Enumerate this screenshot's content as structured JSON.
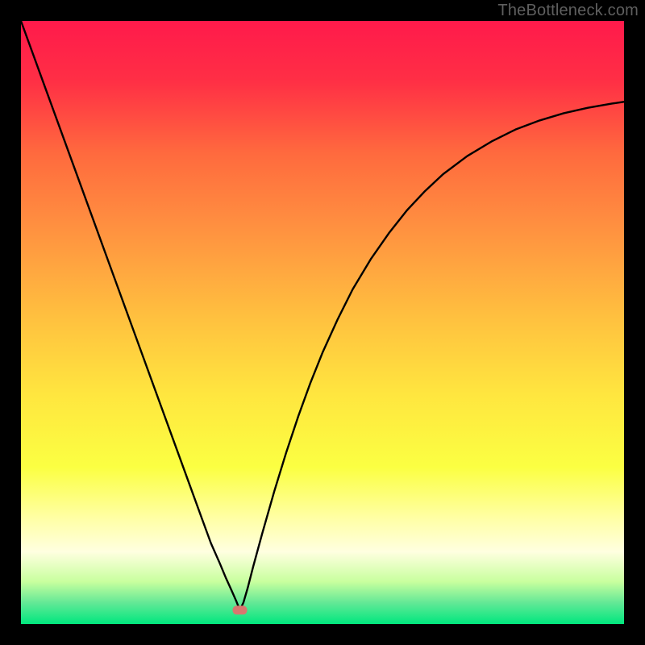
{
  "watermark": "TheBottleneck.com",
  "chart_data": {
    "type": "line",
    "title": "",
    "xlabel": "",
    "ylabel": "",
    "xlim": [
      0,
      100
    ],
    "ylim": [
      0,
      100
    ],
    "grid": false,
    "legend": false,
    "background_gradient": {
      "stops": [
        {
          "offset": 0.0,
          "color": "#ff1a4b"
        },
        {
          "offset": 0.1,
          "color": "#ff2f45"
        },
        {
          "offset": 0.22,
          "color": "#ff6a3e"
        },
        {
          "offset": 0.35,
          "color": "#ff9340"
        },
        {
          "offset": 0.5,
          "color": "#ffc33f"
        },
        {
          "offset": 0.62,
          "color": "#ffe63f"
        },
        {
          "offset": 0.74,
          "color": "#fbff42"
        },
        {
          "offset": 0.82,
          "color": "#ffffa0"
        },
        {
          "offset": 0.88,
          "color": "#ffffe0"
        },
        {
          "offset": 0.93,
          "color": "#c8ff9e"
        },
        {
          "offset": 0.965,
          "color": "#62e896"
        },
        {
          "offset": 1.0,
          "color": "#00e77e"
        }
      ]
    },
    "minimum_marker": {
      "x": 36.3,
      "y": 2.3,
      "color": "#d8776f"
    },
    "series": [
      {
        "name": "curve",
        "color": "#000000",
        "x": [
          0.0,
          2.0,
          4.0,
          6.0,
          8.0,
          10.0,
          12.0,
          14.0,
          16.0,
          18.0,
          20.0,
          22.0,
          24.0,
          26.0,
          28.0,
          30.0,
          31.5,
          33.0,
          34.0,
          35.0,
          35.7,
          36.3,
          36.9,
          37.6,
          38.5,
          40.0,
          42.0,
          44.0,
          46.0,
          48.0,
          50.0,
          52.5,
          55.0,
          58.0,
          61.0,
          64.0,
          67.0,
          70.0,
          74.0,
          78.0,
          82.0,
          86.0,
          90.0,
          94.0,
          98.0,
          100.0
        ],
        "y": [
          100.0,
          94.5,
          89.0,
          83.5,
          78.0,
          72.5,
          67.0,
          61.5,
          56.0,
          50.5,
          45.0,
          39.5,
          34.0,
          28.5,
          23.0,
          17.5,
          13.4,
          10.0,
          7.6,
          5.4,
          3.8,
          2.3,
          3.6,
          6.0,
          9.5,
          15.0,
          22.0,
          28.5,
          34.5,
          40.0,
          45.0,
          50.5,
          55.5,
          60.5,
          64.8,
          68.6,
          71.8,
          74.6,
          77.6,
          80.0,
          82.0,
          83.5,
          84.7,
          85.6,
          86.3,
          86.6
        ]
      }
    ]
  }
}
